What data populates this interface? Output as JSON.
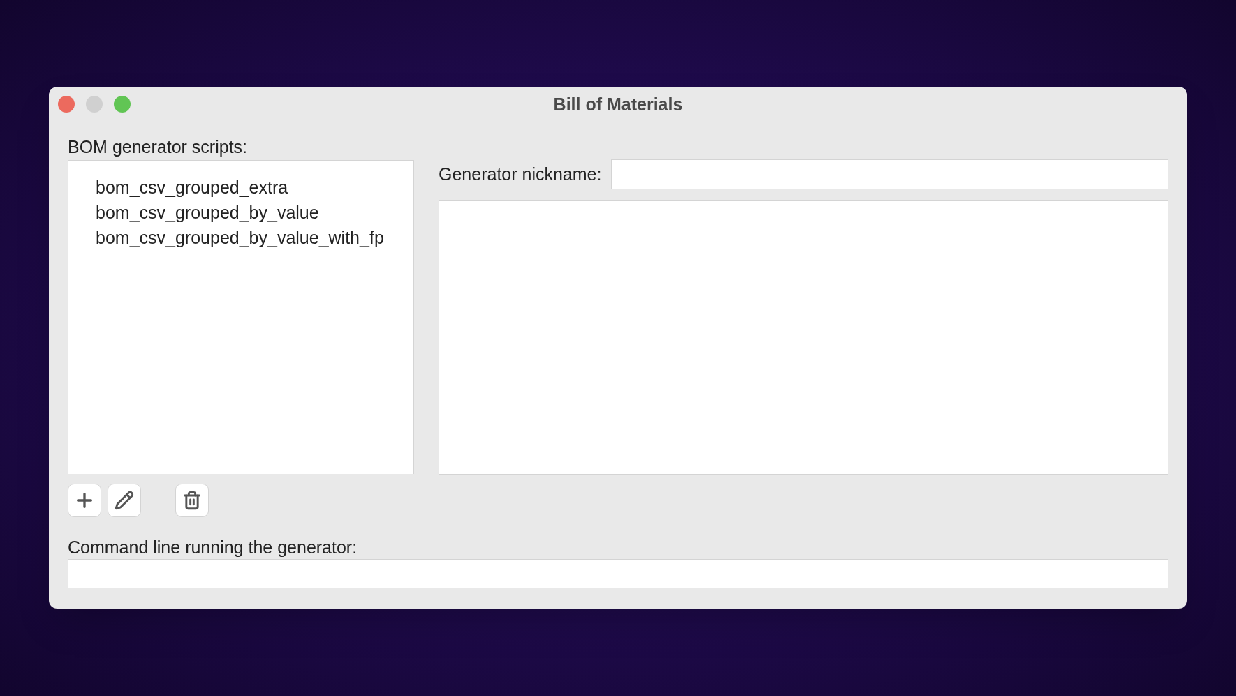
{
  "window": {
    "title": "Bill of Materials"
  },
  "scripts": {
    "label": "BOM generator scripts:",
    "items": [
      "bom_csv_grouped_extra",
      "bom_csv_grouped_by_value",
      "bom_csv_grouped_by_value_with_fp"
    ]
  },
  "nickname": {
    "label": "Generator nickname:"
  },
  "command": {
    "label": "Command line running the generator:"
  }
}
